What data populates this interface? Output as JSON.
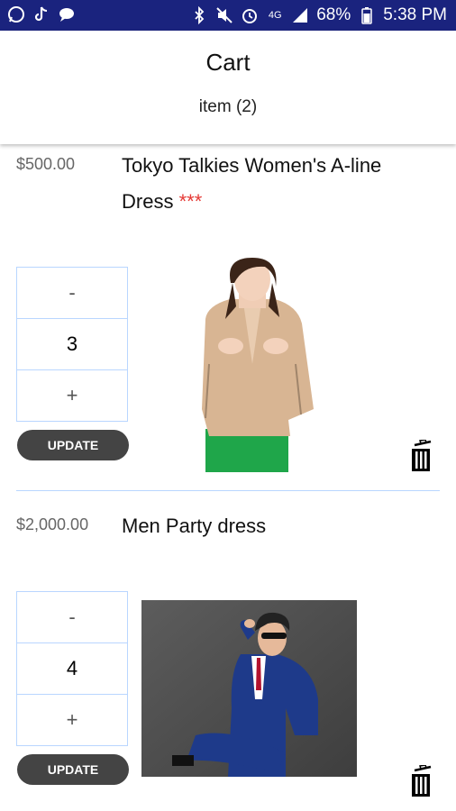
{
  "status_bar": {
    "left_icons": [
      "whatsapp-icon",
      "tiktok-icon",
      "chat-bubble-icon"
    ],
    "right_icons": [
      "bluetooth-icon",
      "mute-icon",
      "alarm-icon",
      "4g-icon",
      "signal-icon"
    ],
    "network": "4G",
    "battery": "68%",
    "time": "5:38 PM"
  },
  "header": {
    "title": "Cart",
    "subtitle": "item  (2)"
  },
  "items": [
    {
      "price": "$500.00",
      "name": "Tokyo Talkies Women's A-line Dress",
      "stars": "***",
      "qty_minus": "-",
      "qty_value": "3",
      "qty_plus": "+",
      "update_label": "UPDATE"
    },
    {
      "price": "$2,000.00",
      "name": "Men Party dress",
      "stars": "",
      "qty_minus": "-",
      "qty_value": "4",
      "qty_plus": "+",
      "update_label": "UPDATE"
    }
  ],
  "colors": {
    "status_bar": "#1a237e",
    "divider": "#b9d6ff",
    "update_button": "#444444",
    "stars": "#e53935"
  }
}
